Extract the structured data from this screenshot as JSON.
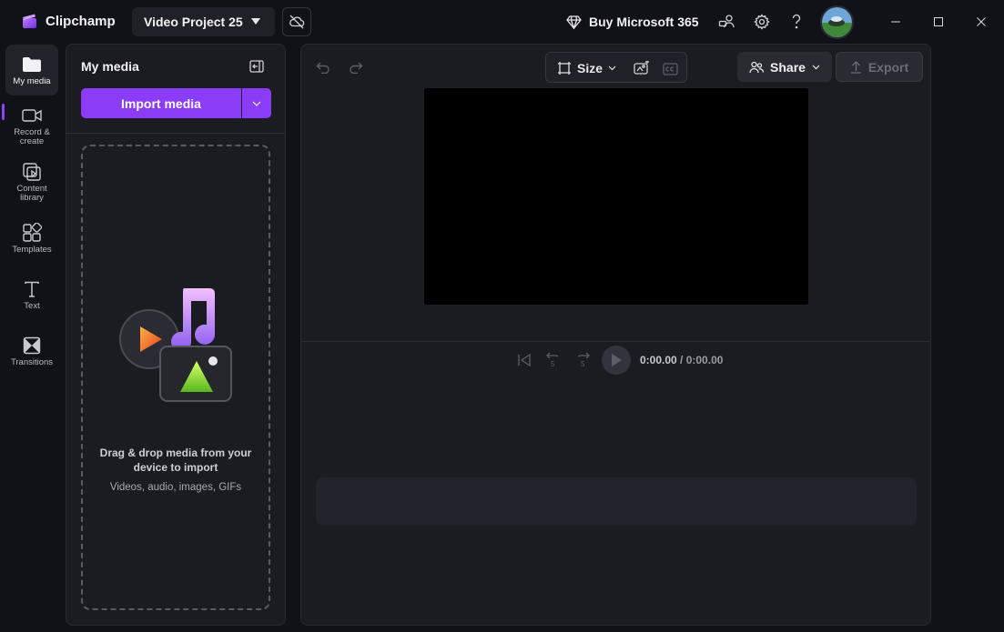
{
  "app": {
    "name": "Clipchamp"
  },
  "header": {
    "project_title": "Video Project 25",
    "buy_label": "Buy Microsoft 365"
  },
  "nav": {
    "items": [
      {
        "label": "My media",
        "icon": "folder-icon"
      },
      {
        "label": "Record & create",
        "icon": "video-camera-icon"
      },
      {
        "label": "Content library",
        "icon": "library-icon"
      },
      {
        "label": "Templates",
        "icon": "templates-icon"
      },
      {
        "label": "Text",
        "icon": "text-icon"
      },
      {
        "label": "Transitions",
        "icon": "transitions-icon"
      }
    ]
  },
  "media": {
    "title": "My media",
    "import_label": "Import media",
    "drop_title": "Drag & drop media from your device to import",
    "drop_subtitle": "Videos, audio, images, GIFs"
  },
  "editor": {
    "size_label": "Size",
    "share_label": "Share",
    "export_label": "Export",
    "time_current": "0:00.00",
    "time_total": "/ 0:00.00"
  },
  "colors": {
    "accent": "#8b3cf7",
    "background": "#111118",
    "panel": "#1b1b22"
  }
}
